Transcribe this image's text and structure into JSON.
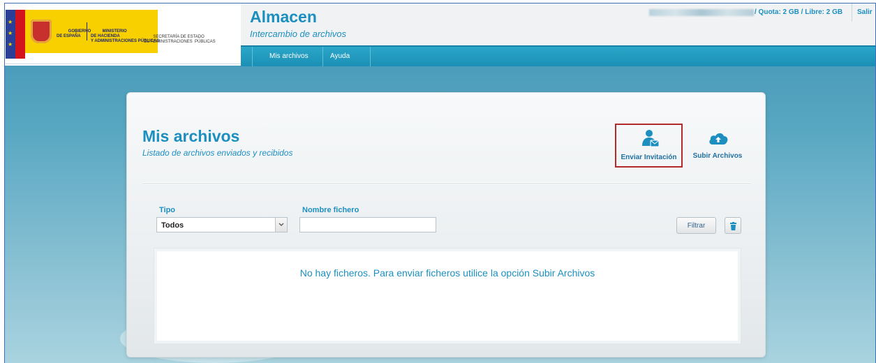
{
  "header": {
    "logo": {
      "gov_line1": "GOBIERNO",
      "gov_line2": "DE ESPAÑA",
      "ministry_line1": "MINISTERIO",
      "ministry_line2": "DE HACIENDA",
      "ministry_line3": "Y ADMINISTRACIONES PÚBLICAS",
      "secretary_line1": "SECRETARÍA DE ESTADO",
      "secretary_line2": "DE ADMINISTRACIONES  PÚBLICAS"
    },
    "app_title": "Almacen",
    "app_subtitle": "Intercambio de archivos",
    "quota": "/ Quota: 2 GB / Libre: 2 GB",
    "logout_label": "Salir"
  },
  "nav": {
    "items": [
      {
        "label": "Mis archivos"
      },
      {
        "label": "Ayuda"
      }
    ]
  },
  "main": {
    "title": "Mis archivos",
    "subtitle": "Listado de archivos enviados y recibidos",
    "actions": {
      "invite_label": "Enviar Invitación",
      "upload_label": "Subir Archivos"
    },
    "filters": {
      "type_label": "Tipo",
      "type_selected": "Todos",
      "filename_label": "Nombre fichero",
      "filename_value": "",
      "filter_button": "Filtrar"
    },
    "empty_message": "No hay ficheros. Para enviar ficheros utilice la opción Subir Archivos"
  },
  "colors": {
    "accent": "#1c8fc0",
    "nav_bar": "#1b8fb5",
    "highlight_border": "#b32a2a"
  },
  "icons": [
    "user-mail-icon",
    "cloud-upload-icon",
    "trash-icon",
    "chevron-down-icon"
  ]
}
